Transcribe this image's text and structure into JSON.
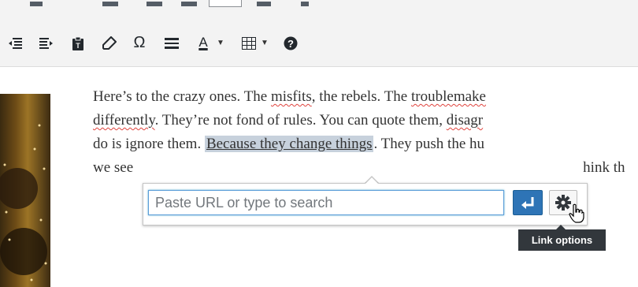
{
  "toolbar": {
    "buttons": [
      {
        "name": "outdent-icon",
        "label": "Decrease indent"
      },
      {
        "name": "indent-icon",
        "label": "Increase indent"
      },
      {
        "name": "paste-as-text-icon",
        "label": "Paste as text"
      },
      {
        "name": "clear-formatting-icon",
        "label": "Clear formatting"
      },
      {
        "name": "special-character-icon",
        "glyph": "Ω"
      },
      {
        "name": "horizontal-line-icon",
        "label": "Horizontal line"
      },
      {
        "name": "text-color-icon",
        "glyph": "A"
      },
      {
        "name": "table-icon",
        "label": "Table"
      },
      {
        "name": "help-icon",
        "glyph": "?"
      }
    ]
  },
  "content": {
    "lines": [
      [
        "Here’s to the crazy ones. The ",
        "misfits",
        ", the rebels. The ",
        "troublemake"
      ],
      [
        "differently",
        ". They’re not fond of rules. You can quote them, ",
        "disagr"
      ],
      [
        "do is ignore them. ",
        "Because they change things",
        ". They push the hu"
      ],
      [
        "we see",
        "",
        "",
        "hink th"
      ]
    ]
  },
  "link_popup": {
    "placeholder": "Paste URL or type to search",
    "apply_icon": "enter-arrow-icon",
    "options_icon": "gear-icon",
    "tooltip": "Link options"
  },
  "colors": {
    "accent": "#2e74b6",
    "selection": "#b4d5ff",
    "tooltip_bg": "#32373c"
  }
}
